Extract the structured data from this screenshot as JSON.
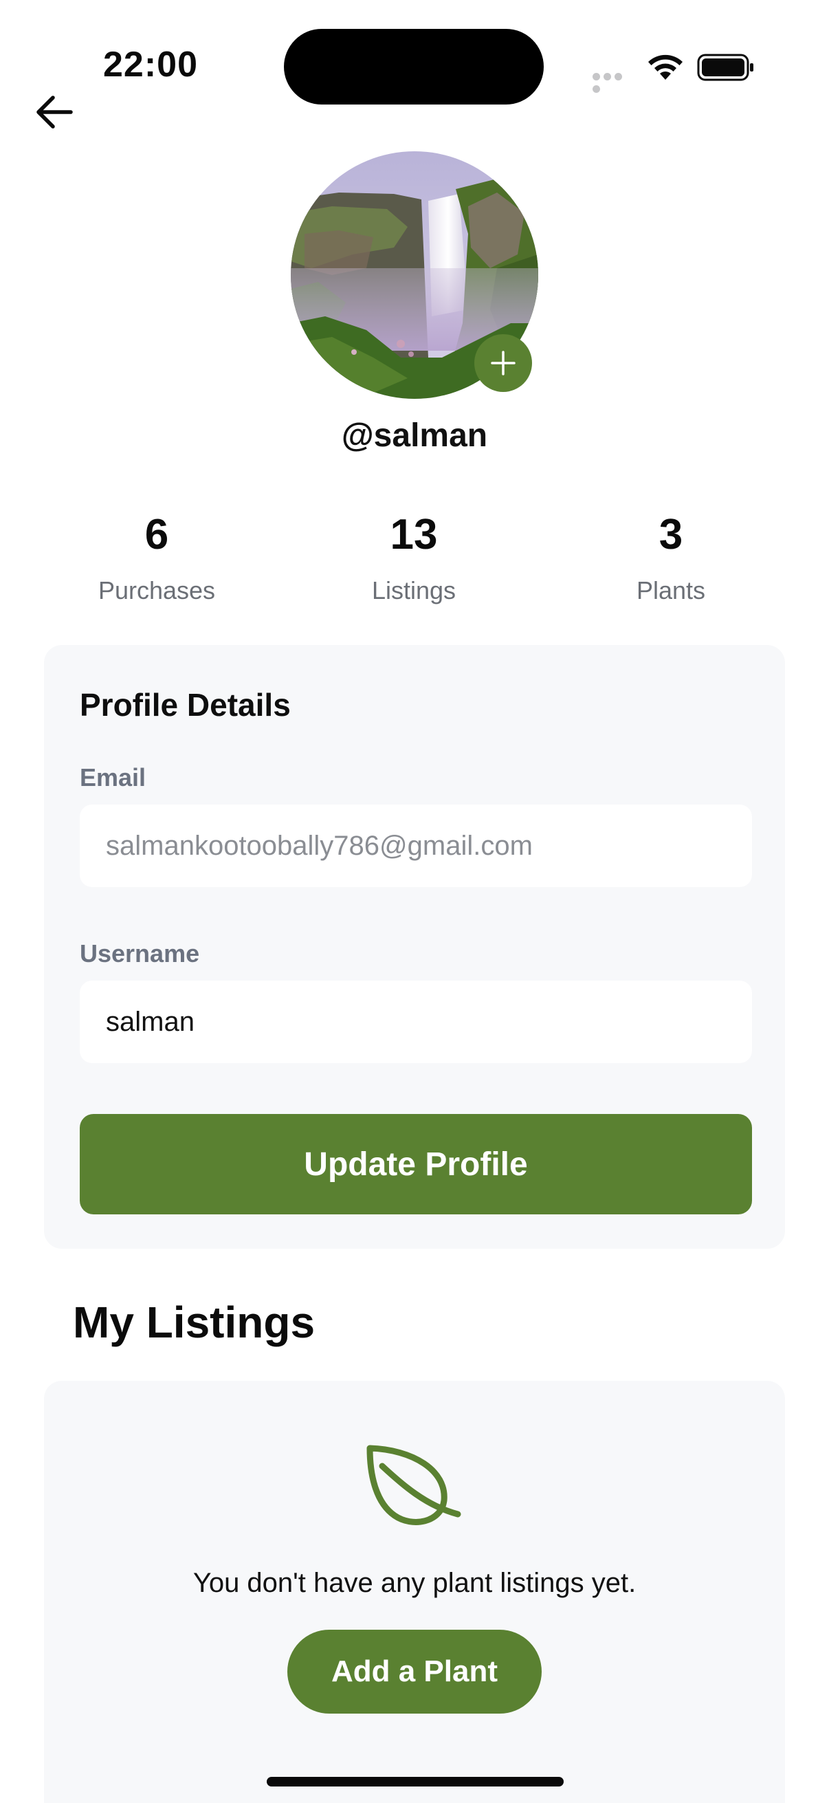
{
  "status_bar": {
    "time": "22:00"
  },
  "profile": {
    "handle": "@salman",
    "stats": [
      {
        "value": "6",
        "label": "Purchases"
      },
      {
        "value": "13",
        "label": "Listings"
      },
      {
        "value": "3",
        "label": "Plants"
      }
    ]
  },
  "profile_details": {
    "title": "Profile Details",
    "email_label": "Email",
    "email_value": "salmankootoobally786@gmail.com",
    "username_label": "Username",
    "username_value": "salman",
    "update_button": "Update Profile"
  },
  "my_listings": {
    "title": "My Listings",
    "empty_message": "You don't have any plant listings yet.",
    "add_button": "Add a Plant"
  },
  "icons": {
    "back": "arrow-left-icon",
    "add_photo": "plus-icon",
    "empty_state": "leaf-icon"
  },
  "colors": {
    "accent": "#5a8131",
    "card_bg": "#f7f8fa",
    "muted_text": "#6b7280"
  }
}
